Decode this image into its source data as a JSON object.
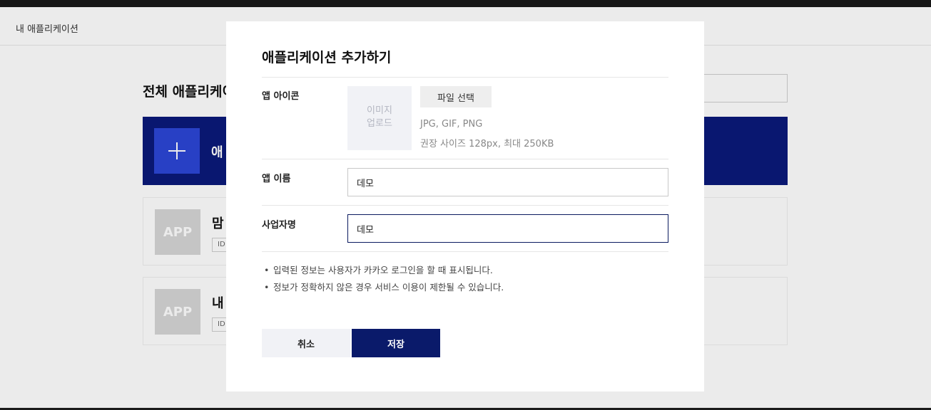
{
  "nav": {
    "title": "내 애플리케이션"
  },
  "page": {
    "heading": "전체 애플리케이",
    "add_card_label": "애"
  },
  "apps": [
    {
      "thumb": "APP",
      "name": "맘",
      "id_badge": "ID"
    },
    {
      "thumb": "APP",
      "name": "내",
      "id_badge": "ID"
    }
  ],
  "modal": {
    "title": "애플리케이션 추가하기",
    "icon_label": "앱 아이콘",
    "upload_line1": "이미지",
    "upload_line2": "업로드",
    "file_button": "파일 선택",
    "file_types": "JPG, GIF, PNG",
    "file_size_hint": "권장 사이즈 128px, 최대 250KB",
    "app_name_label": "앱 이름",
    "app_name_value": "데모",
    "company_label": "사업자명",
    "company_value": "데모",
    "notes": [
      "입력된 정보는 사용자가 카카오 로그인을 할 때 표시됩니다.",
      "정보가 정확하지 않은 경우 서비스 이용이 제한될 수 있습니다."
    ],
    "cancel_label": "취소",
    "save_label": "저장"
  },
  "colors": {
    "primary_navy": "#0a1a6a",
    "add_card_blue": "#0a1a7a",
    "plus_box_blue": "#2c46d6"
  }
}
